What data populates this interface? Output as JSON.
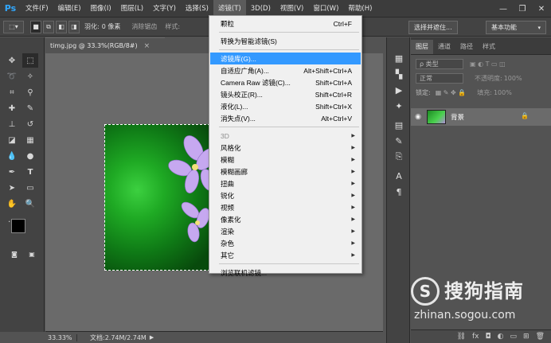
{
  "app": {
    "logo": "Ps"
  },
  "menubar": {
    "items": [
      "文件(F)",
      "编辑(E)",
      "图像(I)",
      "图层(L)",
      "文字(Y)",
      "选择(S)",
      "滤镜(T)",
      "3D(D)",
      "视图(V)",
      "窗口(W)",
      "帮助(H)"
    ],
    "active_index": 6
  },
  "window_controls": {
    "minimize": "—",
    "restore": "❐",
    "close": "✕"
  },
  "options_bar": {
    "feather_label": "羽化:",
    "feather_value": "0 像素",
    "antialias_label": "消除锯齿",
    "style_label": "样式:",
    "select_and_mask": "选择并遮住...",
    "workspace": "基本功能"
  },
  "document": {
    "tab_title": "timg.jpg @ 33.3%(RGB/8#)",
    "close_glyph": "×",
    "zoom": "33.33%",
    "doc_info": "文档:2.74M/2.74M"
  },
  "filter_menu": {
    "items": [
      {
        "label": "颗粒",
        "shortcut": "Ctrl+F",
        "type": "item"
      },
      {
        "type": "sep"
      },
      {
        "label": "转换为智能滤镜(S)",
        "shortcut": "",
        "type": "item"
      },
      {
        "type": "sep"
      },
      {
        "label": "滤镜库(G)...",
        "shortcut": "",
        "type": "item",
        "highlight": true
      },
      {
        "label": "自适应广角(A)...",
        "shortcut": "Alt+Shift+Ctrl+A",
        "type": "item"
      },
      {
        "label": "Camera Raw 滤镜(C)...",
        "shortcut": "Shift+Ctrl+A",
        "type": "item"
      },
      {
        "label": "镜头校正(R)...",
        "shortcut": "Shift+Ctrl+R",
        "type": "item"
      },
      {
        "label": "液化(L)...",
        "shortcut": "Shift+Ctrl+X",
        "type": "item"
      },
      {
        "label": "消失点(V)...",
        "shortcut": "Alt+Ctrl+V",
        "type": "item"
      },
      {
        "type": "sep"
      },
      {
        "label": "3D",
        "type": "submenu",
        "disabled": true
      },
      {
        "label": "风格化",
        "type": "submenu"
      },
      {
        "label": "模糊",
        "type": "submenu"
      },
      {
        "label": "模糊画廊",
        "type": "submenu"
      },
      {
        "label": "扭曲",
        "type": "submenu"
      },
      {
        "label": "锐化",
        "type": "submenu"
      },
      {
        "label": "视频",
        "type": "submenu"
      },
      {
        "label": "像素化",
        "type": "submenu"
      },
      {
        "label": "渲染",
        "type": "submenu"
      },
      {
        "label": "杂色",
        "type": "submenu"
      },
      {
        "label": "其它",
        "type": "submenu"
      },
      {
        "type": "sep"
      },
      {
        "label": "浏览联机滤镜...",
        "shortcut": "",
        "type": "item"
      }
    ]
  },
  "layers_panel": {
    "tabs": [
      "图层",
      "通道",
      "路径",
      "样式"
    ],
    "kind_filter": "ρ 类型",
    "blend_mode": "正常",
    "opacity_label": "不透明度:",
    "opacity_value": "100%",
    "lock_label": "锁定:",
    "fill_label": "填充:",
    "fill_value": "100%",
    "layer_name": "背景",
    "footer_icons": [
      "link-icon",
      "fx-icon",
      "mask-icon",
      "adjustment-icon",
      "group-icon",
      "new-layer-icon",
      "trash-icon"
    ]
  },
  "watermark": {
    "logo_glyph": "S",
    "brand": "搜狗指南",
    "url": "zhinan.sogou.com"
  }
}
